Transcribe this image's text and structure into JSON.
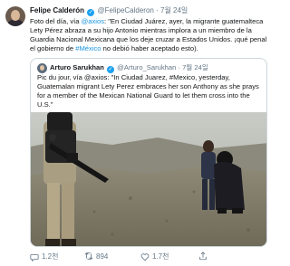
{
  "tweet": {
    "author_name": "Felipe Calderón",
    "author_handle": "@FelipeCalderon",
    "separator": "·",
    "date": "7월 24일",
    "text_part1": "Foto del día, vía ",
    "mention_axios": "@axios",
    "text_part2": ": \"En Ciudad Juárez, ayer, la migrante guatemalteca Lety Pérez abraza a su hijo Antonio mientras implora a un miembro de la Guardia Nacional Mexicana que los deje cruzar a Estados Unidos. ¡qué penal el gobierno de ",
    "hashtag_mexico": "#México",
    "text_part3": " no debió haber aceptado esto)."
  },
  "quoted": {
    "author_name": "Arturo Sarukhan",
    "author_handle": "@Arturo_Sarukhan",
    "separator": "·",
    "date": "7월 24일",
    "text_part1": "Pic du jour, vía ",
    "mention_axios": "@axios",
    "text_part2": ": \"In Ciudad Juarez, ",
    "hashtag_mexico": "#Mexico",
    "text_part3": ", yesterday, Guatemalan migrant Lety Perez embraces her son Anthony as she prays for a member of the Mexican National Guard to let them cross into the U.S.\""
  },
  "actions": {
    "reply_count": "1.2천",
    "retweet_count": "894",
    "like_count": "1.7천"
  },
  "icons": {
    "reply": "reply-icon",
    "retweet": "retweet-icon",
    "like": "heart-icon",
    "share": "share-icon"
  },
  "colors": {
    "link": "#1b95e0",
    "verified": "#1da1f2",
    "meta": "#657786"
  }
}
